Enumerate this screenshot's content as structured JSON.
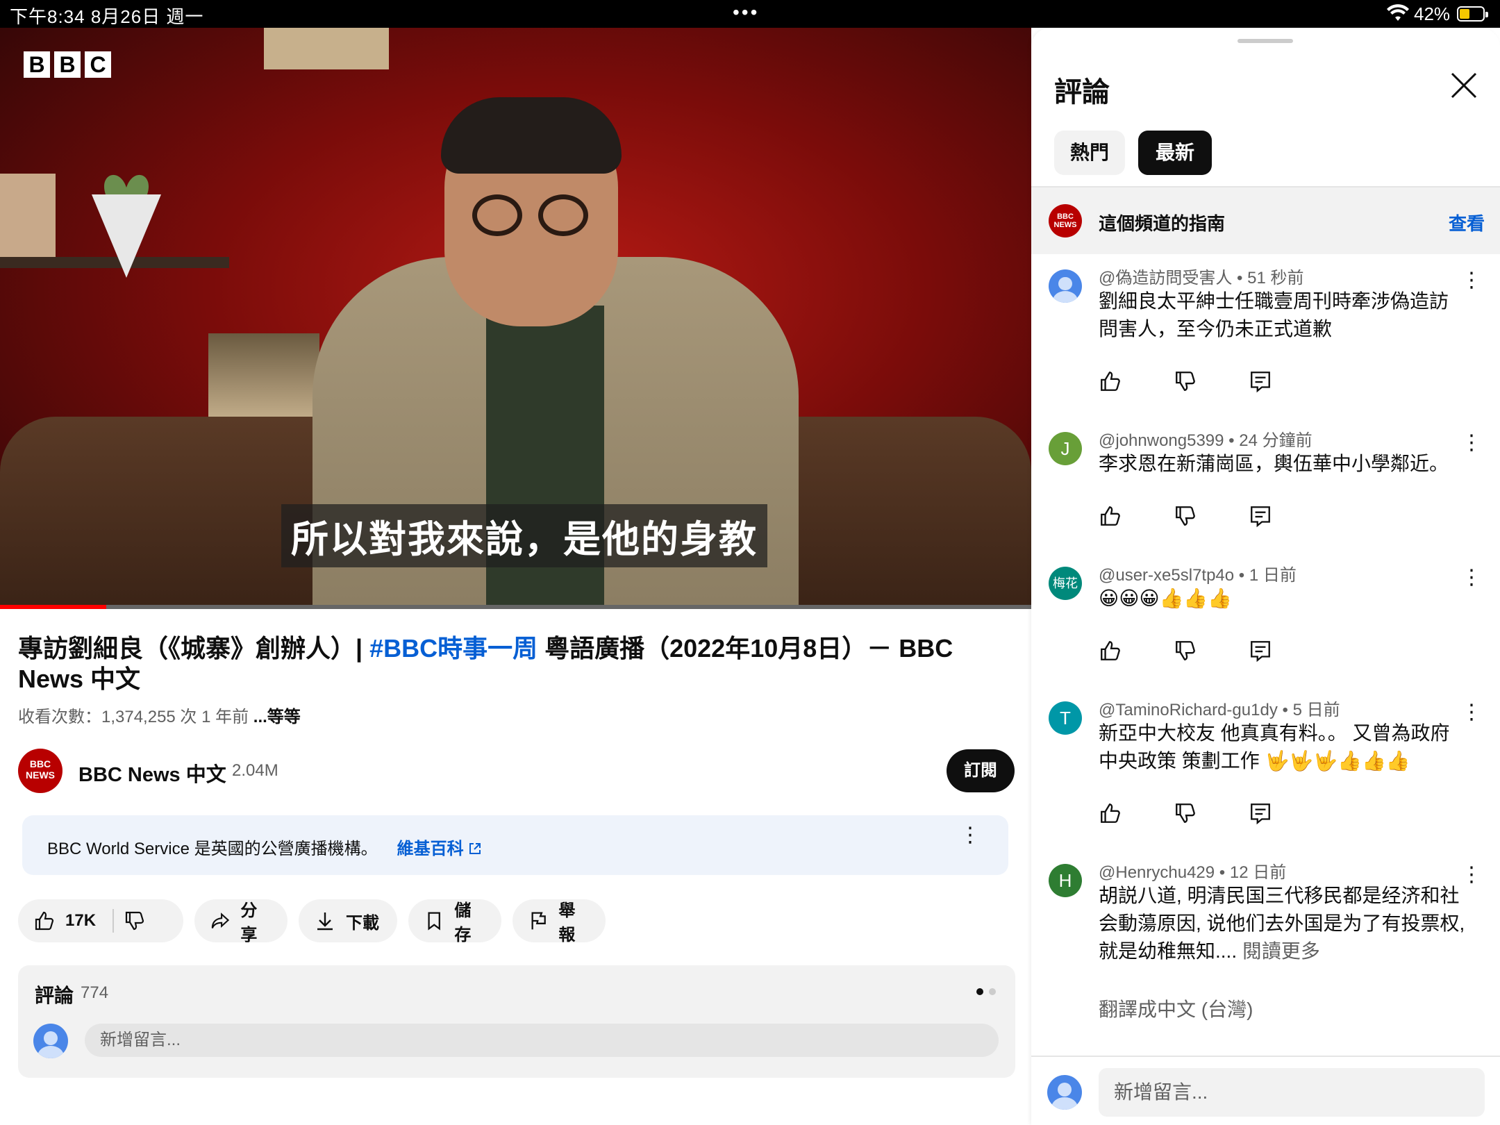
{
  "status_bar": {
    "time_date": "下午8:34   8月26日 週一",
    "center_dots": "•••",
    "battery_percent": "42%"
  },
  "video": {
    "brand": [
      "B",
      "B",
      "C"
    ],
    "subtitle": "所以對我來說，是他的身教",
    "progress": 0.103
  },
  "details": {
    "title_part1": "專訪劉細良（《城寨》創辦人）| ",
    "title_hashtag": "#BBC時事一周",
    "title_part2": " 粵語廣播（2022年10月8日）－ BBC News 中文",
    "meta": "收看次數：1,374,255 次  1 年前  ",
    "meta_more": "...等等",
    "channel_avatar_text": "BBC NEWS",
    "channel_name": "BBC News 中文",
    "subscribers": "2.04M",
    "subscribe_label": "訂閱",
    "info_text": "BBC World Service 是英國的公營廣播機構。",
    "info_link": "維基百科",
    "like_count": "17K",
    "share_label": "分享",
    "download_label": "下載",
    "save_label": "儲存",
    "report_label": "舉報",
    "comments_label": "評論",
    "comments_count": "774",
    "comment_placeholder": "新增留言..."
  },
  "panel": {
    "title": "評論",
    "tabs": [
      {
        "label": "熱門",
        "active": false
      },
      {
        "label": "最新",
        "active": true
      }
    ],
    "guide_avatar_text": "BBC NEWS",
    "guide_text": "這個頻道的指南",
    "guide_link": "查看",
    "comments": [
      {
        "author": "@偽造訪問受害人",
        "time": "51 秒前",
        "text": "劉細良太平紳士任職壹周刊時牽涉偽造訪問害人，至今仍未正式道歉",
        "avatar": "",
        "avatar_color": "#4a86e8"
      },
      {
        "author": "@johnwong5399",
        "time": "24 分鐘前",
        "text": "李求恩在新蒲崗區，輿伍華中小學鄰近。",
        "avatar": "J",
        "avatar_color": "#689f38"
      },
      {
        "author": "@user-xe5sl7tp4o",
        "time": "1 日前",
        "text": "😀😀😀👍👍👍",
        "avatar": "梅花",
        "avatar_color": "#00897b"
      },
      {
        "author": "@TaminoRichard-gu1dy",
        "time": "5 日前",
        "text": "新亞中大校友  他真真有料。。   又曾為政府中央政策  策劃工作 🤟🤟🤟👍👍👍",
        "avatar": "T",
        "avatar_color": "#0097a7"
      },
      {
        "author": "@Henrychu429",
        "time": "12 日前",
        "text": "胡説八道, 明清民国三代移民都是经济和社会動蕩原因, 说他们去外国是为了有投票权, 就是幼稚無知.... ",
        "read_more": "閱讀更多",
        "avatar": "H",
        "avatar_color": "#2e7d32"
      }
    ],
    "translate_label": "翻譯成中文 (台灣)",
    "bottom_placeholder": "新增留言..."
  },
  "colors": {
    "accent_link": "#065fd4",
    "progress_red": "#ff0000",
    "bbc_red": "#b80000"
  }
}
